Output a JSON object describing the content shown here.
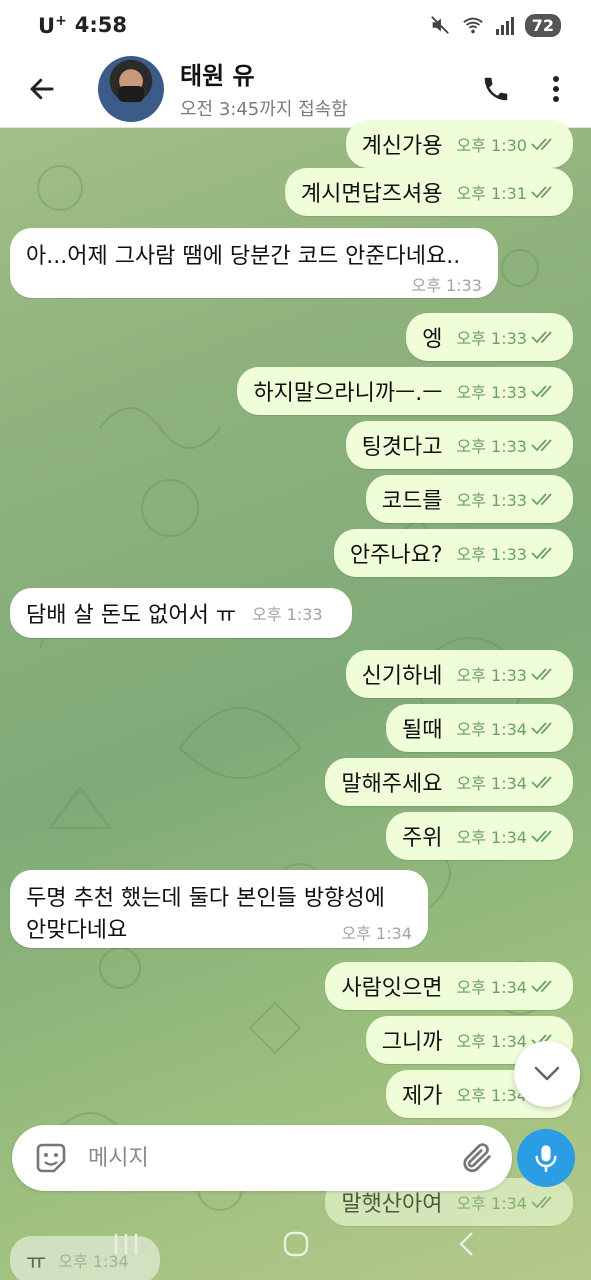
{
  "status_bar": {
    "carrier": "U",
    "carrier_sup": "+",
    "time": "4:58",
    "battery": "72"
  },
  "header": {
    "contact_name": "태원 유",
    "last_seen": "오전 3:45까지 접속함"
  },
  "messages": [
    {
      "dir": "out",
      "text": "계신가용",
      "time": "오후 1:30"
    },
    {
      "dir": "out",
      "text": "계시면답즈셔용",
      "time": "오후 1:31"
    },
    {
      "dir": "in",
      "text": "아...어제 그사람 땜에 당분간 코드 안준다네요..",
      "time": "오후 1:33"
    },
    {
      "dir": "out",
      "text": "엥",
      "time": "오후 1:33"
    },
    {
      "dir": "out",
      "text": "하지말으라니까ㅡ.ㅡ",
      "time": "오후 1:33"
    },
    {
      "dir": "out",
      "text": "팅겻다고",
      "time": "오후 1:33"
    },
    {
      "dir": "out",
      "text": "코드를",
      "time": "오후 1:33"
    },
    {
      "dir": "out",
      "text": "안주나요?",
      "time": "오후 1:33"
    },
    {
      "dir": "in",
      "text": "담배 살 돈도 없어서 ㅠ",
      "time": "오후 1:33"
    },
    {
      "dir": "out",
      "text": "신기하네",
      "time": "오후 1:33"
    },
    {
      "dir": "out",
      "text": "될때",
      "time": "오후 1:34"
    },
    {
      "dir": "out",
      "text": "말해주세요",
      "time": "오후 1:34"
    },
    {
      "dir": "out",
      "text": "주위",
      "time": "오후 1:34"
    },
    {
      "dir": "in",
      "text_line1": "두명 추천 했는데 둘다 본인들 방향성에",
      "text_line2": "안맞다네요",
      "time": "오후 1:34"
    },
    {
      "dir": "out",
      "text": "사람잇으면",
      "time": "오후 1:34"
    },
    {
      "dir": "out",
      "text": "그니까",
      "time": "오후 1:34"
    },
    {
      "dir": "out",
      "text": "제가",
      "time": "오후 1:34"
    },
    {
      "dir": "out",
      "text": "말햇산아여",
      "time": "오후 1:34"
    },
    {
      "dir": "in",
      "text": "ㅠ",
      "time": "오후 1:34"
    }
  ],
  "input": {
    "placeholder": "메시지"
  },
  "colors": {
    "outgoing_bubble": "#f0fdd9",
    "incoming_bubble": "#ffffff",
    "outgoing_meta": "#6aa164",
    "mic_button": "#2a9de4"
  },
  "icons": {
    "back": "arrow-left-icon",
    "call": "phone-icon",
    "menu": "more-vertical-icon",
    "sticker": "sticker-icon",
    "attach": "paperclip-icon",
    "mic": "microphone-icon",
    "scroll_down": "chevron-down-icon"
  }
}
